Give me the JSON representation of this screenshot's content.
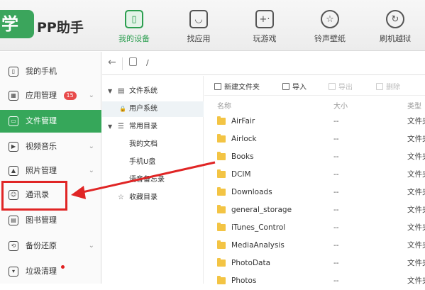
{
  "app": {
    "logo_char": "学",
    "logo_text": "PP助手"
  },
  "nav": [
    {
      "label": "我的设备",
      "icon": "phone-icon",
      "glyph": "▯",
      "active": true
    },
    {
      "label": "找应用",
      "icon": "app-store-icon",
      "glyph": "◡",
      "active": false
    },
    {
      "label": "玩游戏",
      "icon": "gamepad-icon",
      "glyph": "+·",
      "active": false
    },
    {
      "label": "铃声壁纸",
      "icon": "star-icon",
      "glyph": "☆",
      "active": false
    },
    {
      "label": "刷机越狱",
      "icon": "refresh-icon",
      "glyph": "↻",
      "active": false
    }
  ],
  "sidebar": {
    "items": [
      {
        "label": "我的手机",
        "icon": "phone-outline-icon"
      },
      {
        "label": "应用管理",
        "icon": "apps-icon",
        "badge": "15"
      },
      {
        "label": "文件管理",
        "icon": "folder-icon"
      },
      {
        "label": "视频音乐",
        "icon": "video-icon"
      },
      {
        "label": "照片管理",
        "icon": "photo-icon"
      },
      {
        "label": "通讯录",
        "icon": "contacts-icon"
      },
      {
        "label": "图书管理",
        "icon": "book-icon"
      },
      {
        "label": "备份还原",
        "icon": "backup-icon"
      },
      {
        "label": "垃圾清理",
        "icon": "trash-icon"
      }
    ]
  },
  "pathbar": {
    "back": "←",
    "path": "/"
  },
  "tree": {
    "items": [
      {
        "label": "文件系统",
        "twisty": "▼",
        "icon": "▤"
      },
      {
        "label": "用户系统",
        "twisty": "",
        "icon": "🔒"
      },
      {
        "label": "常用目录",
        "twisty": "▼",
        "icon": "☰"
      },
      {
        "label": "我的文档",
        "twisty": "",
        "icon": ""
      },
      {
        "label": "手机U盘",
        "twisty": "",
        "icon": ""
      },
      {
        "label": "语音备忘录",
        "twisty": "",
        "icon": ""
      },
      {
        "label": "收藏目录",
        "twisty": "",
        "icon": "☆"
      }
    ]
  },
  "toolbar": {
    "new_folder": "新建文件夹",
    "import": "导入",
    "export": "导出",
    "delete": "删除"
  },
  "columns": {
    "name": "名称",
    "size": "大小",
    "type": "类型"
  },
  "files": [
    {
      "name": "AirFair",
      "size": "--",
      "type": "文件夹"
    },
    {
      "name": "Airlock",
      "size": "--",
      "type": "文件夹"
    },
    {
      "name": "Books",
      "size": "--",
      "type": "文件夹"
    },
    {
      "name": "DCIM",
      "size": "--",
      "type": "文件夹"
    },
    {
      "name": "Downloads",
      "size": "--",
      "type": "文件夹"
    },
    {
      "name": "general_storage",
      "size": "--",
      "type": "文件夹"
    },
    {
      "name": "iTunes_Control",
      "size": "--",
      "type": "文件夹"
    },
    {
      "name": "MediaAnalysis",
      "size": "--",
      "type": "文件夹"
    },
    {
      "name": "PhotoData",
      "size": "--",
      "type": "文件夹"
    },
    {
      "name": "Photos",
      "size": "--",
      "type": "文件夹"
    }
  ],
  "colors": {
    "accent": "#36a75a",
    "annotation": "#e02525"
  }
}
